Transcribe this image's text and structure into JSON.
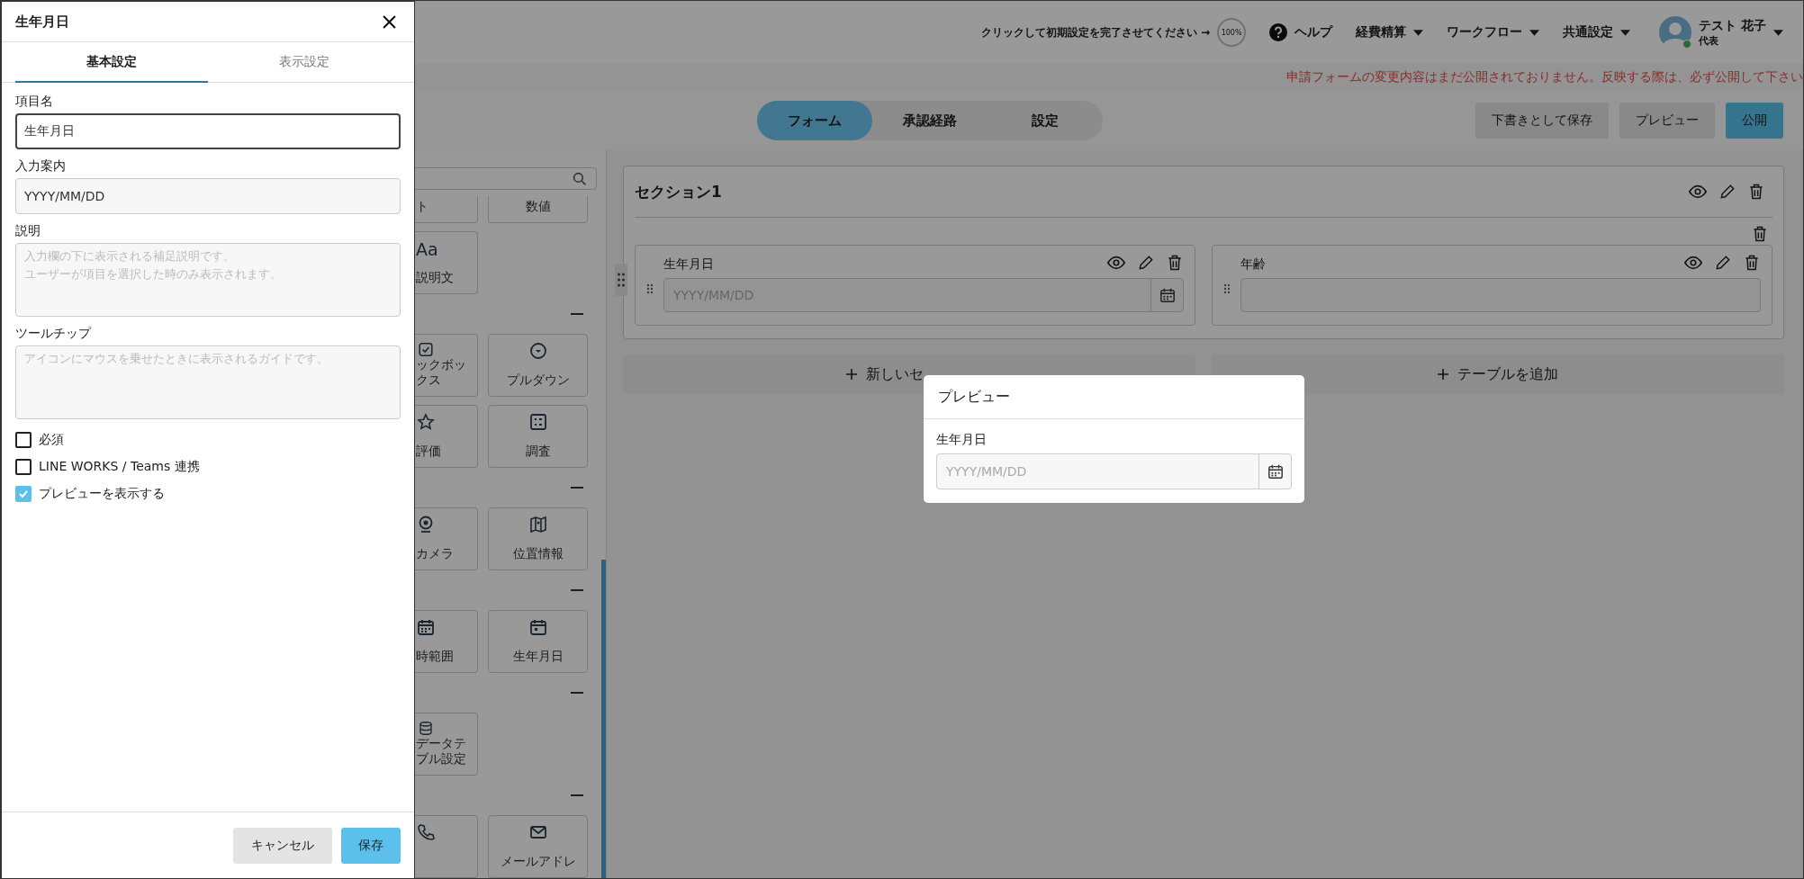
{
  "header": {
    "setup_prompt": "クリックして初期設定を完了させてください →",
    "setup_progress": {
      "text": "100%",
      "level": 1
    },
    "help": "ヘルプ",
    "menus": [
      {
        "label": "経費精算"
      },
      {
        "label": "ワークフロー"
      },
      {
        "label": "共通設定"
      }
    ],
    "user": {
      "name": "テスト 花子",
      "role": "代表",
      "online": true
    }
  },
  "notice": "申請フォームの変更内容はまだ公開されておりません。反映する際は、必ず公開して下さい",
  "editor_tabs": [
    {
      "label": "フォーム",
      "selected": true
    },
    {
      "label": "承認経路",
      "selected": false
    },
    {
      "label": "設定",
      "selected": false
    }
  ],
  "actions": [
    {
      "label": "下書きとして保存",
      "kind": "secondary"
    },
    {
      "label": "プレビュー",
      "kind": "secondary"
    },
    {
      "label": "公開",
      "kind": "primary"
    }
  ],
  "palette": {
    "rows": [
      {
        "kind": "cards",
        "cut": true,
        "cards": [
          {
            "kind": "label",
            "lines": [
              "ト"
            ]
          },
          {
            "kind": "label",
            "lines": [
              "数値"
            ]
          }
        ]
      },
      {
        "kind": "cards",
        "cards": [
          {
            "kind": "glyph",
            "glyph": "Aa",
            "lines": [
              "説明文"
            ]
          }
        ]
      },
      {
        "kind": "divider"
      },
      {
        "kind": "cards",
        "cards": [
          {
            "kind": "icon",
            "lines": [
              "ックボッ",
              "クス"
            ]
          },
          {
            "kind": "icon",
            "lines": [
              "プルダウン"
            ]
          }
        ]
      },
      {
        "kind": "cards",
        "cards": [
          {
            "kind": "icon",
            "lines": [
              "評価"
            ]
          },
          {
            "kind": "icon",
            "lines": [
              "調査"
            ]
          }
        ]
      },
      {
        "kind": "divider"
      },
      {
        "kind": "cards",
        "cards": [
          {
            "kind": "icon",
            "lines": [
              "カメラ"
            ]
          },
          {
            "kind": "icon",
            "lines": [
              "位置情報"
            ]
          }
        ]
      },
      {
        "kind": "divider"
      },
      {
        "kind": "cards",
        "cards": [
          {
            "kind": "icon",
            "lines": [
              "時範囲"
            ]
          },
          {
            "kind": "icon",
            "lines": [
              "生年月日"
            ]
          }
        ]
      },
      {
        "kind": "divider"
      },
      {
        "kind": "cards",
        "cards": [
          {
            "kind": "icon",
            "lines": [
              "データテ",
              "ブル設定"
            ]
          }
        ]
      },
      {
        "kind": "divider"
      },
      {
        "kind": "cards",
        "cards": [
          {
            "kind": "icon_only"
          },
          {
            "kind": "icon",
            "lines": [
              "メールアドレ"
            ]
          }
        ]
      }
    ]
  },
  "form": {
    "section": {
      "title": "セクション1",
      "fields": [
        {
          "label": "生年月日",
          "kind": "date",
          "placeholder": "YYYY/MM/DD"
        },
        {
          "label": "年齢",
          "kind": "text"
        }
      ]
    },
    "add_buttons": [
      "新しいセ",
      "テーブルを追加"
    ]
  },
  "drawer": {
    "title": "生年月日",
    "tabs": [
      {
        "label": "基本設定",
        "selected": true
      },
      {
        "label": "表示設定",
        "selected": false
      }
    ],
    "fields": [
      {
        "kind": "input",
        "label": "項目名",
        "value": "生年月日",
        "focused": true
      },
      {
        "kind": "input",
        "label": "入力案内",
        "value": "YYYY/MM/DD",
        "focused": false
      },
      {
        "kind": "textarea",
        "label": "説明",
        "placeholder": [
          "入力欄の下に表示される補足説明です。",
          "ユーザーが項目を選択した時のみ表示されます。"
        ]
      },
      {
        "kind": "textarea",
        "label": "ツールチップ",
        "placeholder": [
          "アイコンにマウスを乗せたときに表示されるガイドです。"
        ]
      }
    ],
    "checkboxes": [
      {
        "label": "必須",
        "checked": false
      },
      {
        "label": "LINE WORKS / Teams 連携",
        "checked": false
      },
      {
        "label": "プレビューを表示する",
        "checked": true
      }
    ],
    "buttons": [
      {
        "label": "キャンセル",
        "kind": "secondary"
      },
      {
        "label": "保存",
        "kind": "primary"
      }
    ]
  },
  "preview": {
    "title": "プレビュー",
    "label": "生年月日",
    "placeholder": "YYYY/MM/DD"
  }
}
